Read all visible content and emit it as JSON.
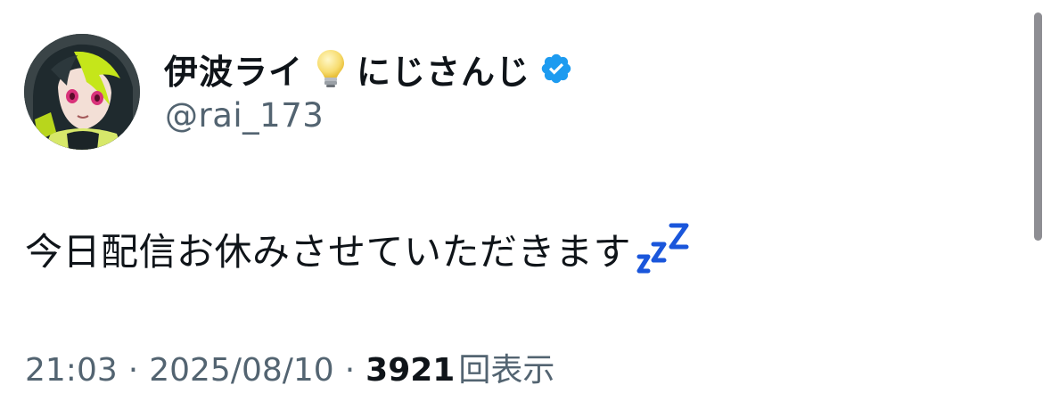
{
  "author": {
    "display_name": "伊波ライ",
    "affiliation": "にじさんじ",
    "handle": "@rai_173",
    "name_emoji": "light-bulb-icon",
    "verified_badge": "verified-icon",
    "verified_color": "#1d9bf0"
  },
  "tweet": {
    "text": "今日配信お休みさせていただきます",
    "trailing_emoji": "zzz-icon",
    "emoji_color": "#1a56db"
  },
  "meta": {
    "time": "21:03",
    "separator": "·",
    "date": "2025/08/10",
    "views_count": "3921",
    "views_label": "回表示"
  }
}
